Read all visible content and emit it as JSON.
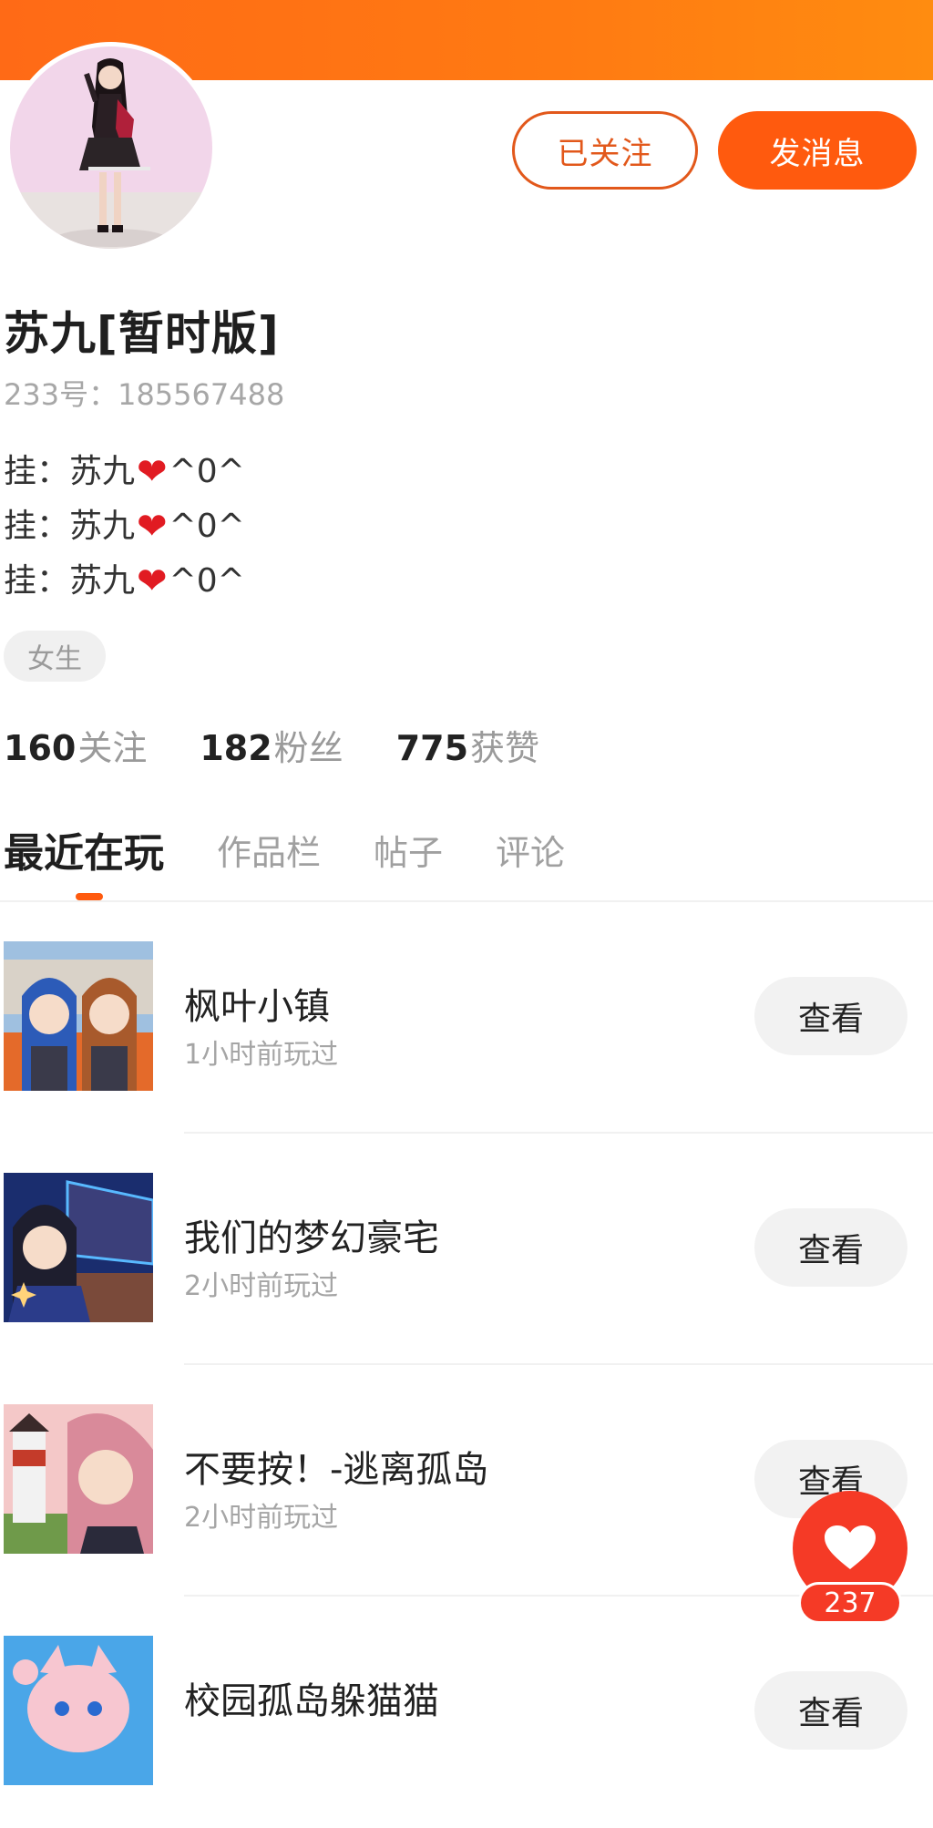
{
  "colors": {
    "brand_orange": "#ff5a0e",
    "header_gradient_start": "#ff6a16",
    "header_gradient_end": "#ff8c10",
    "like_red": "#f53a26"
  },
  "profile": {
    "name": "苏九[暂时版]",
    "uid_label": "233号：185567488",
    "bio_lines": [
      {
        "prefix": "挂：苏九",
        "emoji_icon": "red-heart",
        "suffix": "^0^"
      },
      {
        "prefix": "挂：苏九",
        "emoji_icon": "red-heart",
        "suffix": "^0^"
      },
      {
        "prefix": "挂：苏九",
        "emoji_icon": "red-heart",
        "suffix": "^0^"
      }
    ],
    "tag": "女生"
  },
  "actions": {
    "follow_label": "已关注",
    "message_label": "发消息"
  },
  "stats": [
    {
      "num": "160",
      "label": "关注"
    },
    {
      "num": "182",
      "label": "粉丝"
    },
    {
      "num": "775",
      "label": "获赞"
    }
  ],
  "tabs": [
    {
      "label": "最近在玩",
      "active": true
    },
    {
      "label": "作品栏",
      "active": false
    },
    {
      "label": "帖子",
      "active": false
    },
    {
      "label": "评论",
      "active": false
    }
  ],
  "games": [
    {
      "title": "枫叶小镇",
      "time": "1小时前玩过",
      "button": "查看"
    },
    {
      "title": "我们的梦幻豪宅",
      "time": "2小时前玩过",
      "button": "查看"
    },
    {
      "title": "不要按！-逃离孤岛",
      "time": "2小时前玩过",
      "button": "查看"
    },
    {
      "title": "校园孤岛躲猫猫",
      "time": "",
      "button": "查看"
    }
  ],
  "like_button": {
    "icon": "heart-icon",
    "count": "237"
  }
}
